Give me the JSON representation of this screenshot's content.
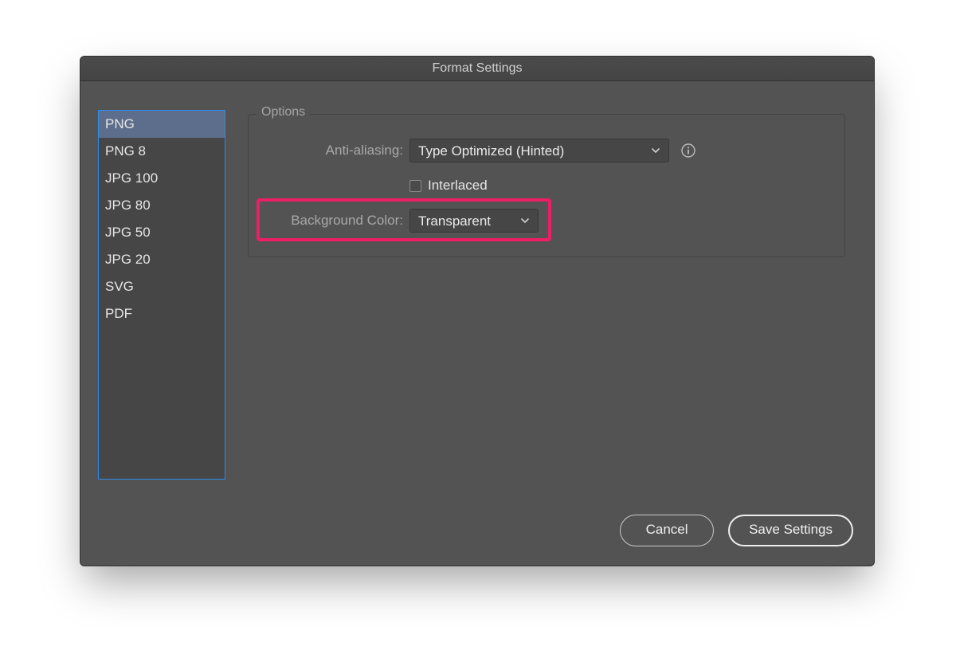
{
  "title": "Format Settings",
  "sidebar": {
    "items": [
      {
        "label": "PNG",
        "selected": true
      },
      {
        "label": "PNG 8",
        "selected": false
      },
      {
        "label": "JPG 100",
        "selected": false
      },
      {
        "label": "JPG 80",
        "selected": false
      },
      {
        "label": "JPG 50",
        "selected": false
      },
      {
        "label": "JPG 20",
        "selected": false
      },
      {
        "label": "SVG",
        "selected": false
      },
      {
        "label": "PDF",
        "selected": false
      }
    ]
  },
  "options": {
    "legend": "Options",
    "anti_aliasing": {
      "label": "Anti-aliasing:",
      "value": "Type Optimized (Hinted)"
    },
    "interlaced": {
      "label": "Interlaced",
      "checked": false
    },
    "background_color": {
      "label": "Background Color:",
      "value": "Transparent"
    }
  },
  "buttons": {
    "cancel": "Cancel",
    "save": "Save Settings"
  },
  "highlight": {
    "target": "background-color-row"
  }
}
